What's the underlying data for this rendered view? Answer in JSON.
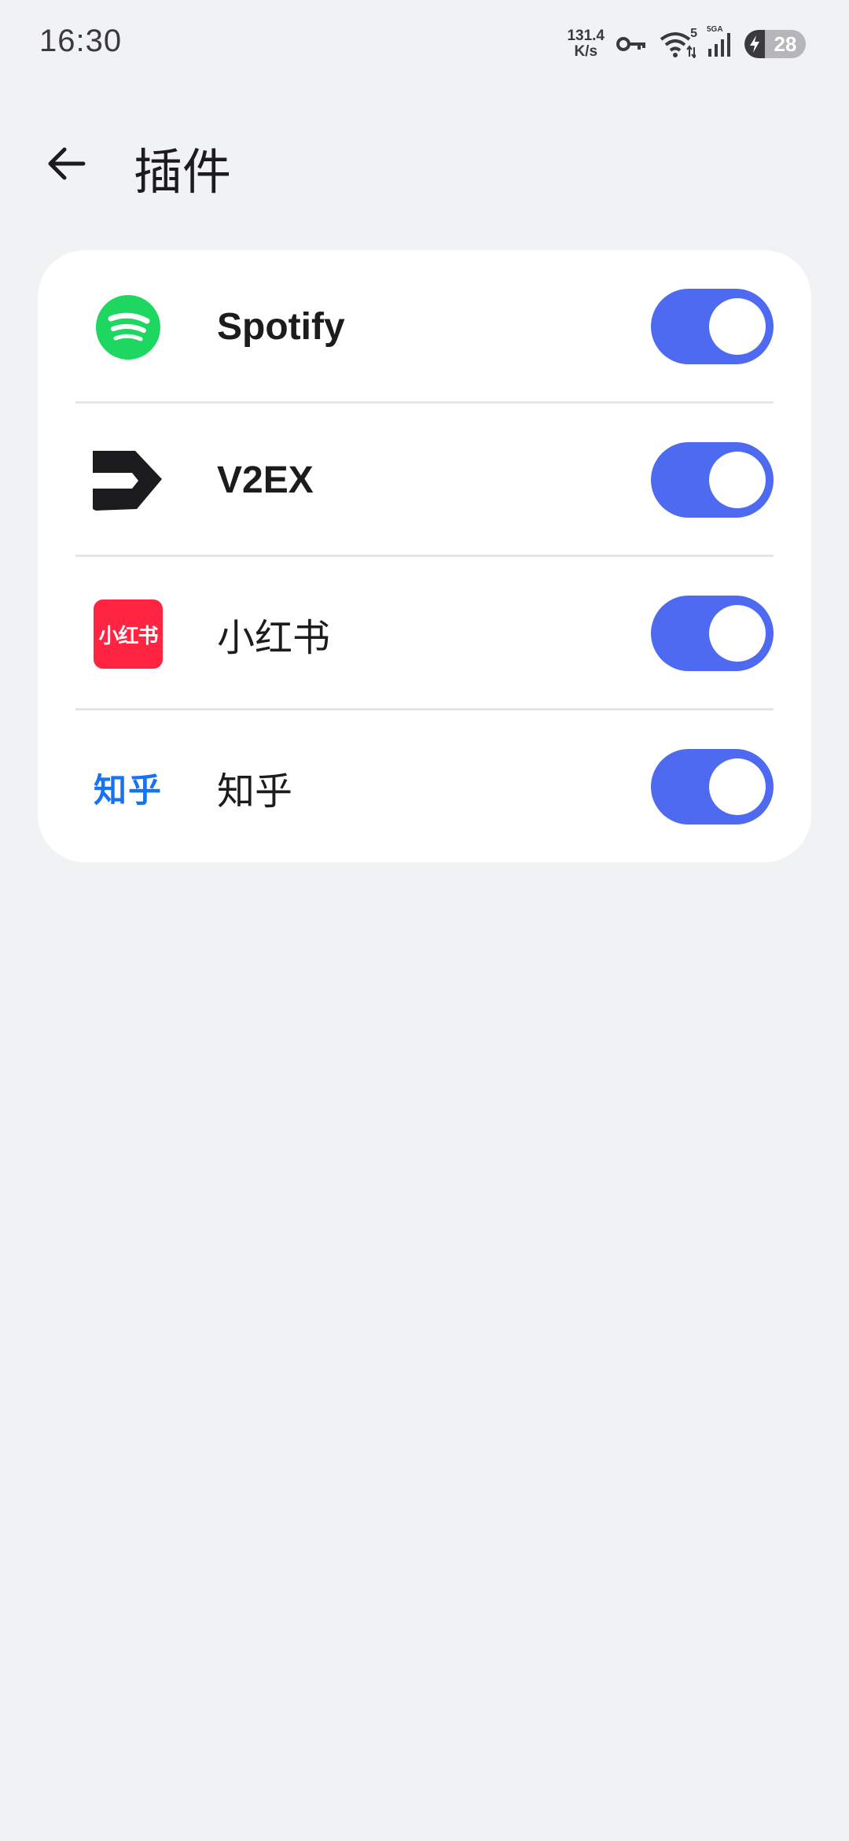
{
  "status_bar": {
    "time": "16:30",
    "net_speed_value": "131.4",
    "net_speed_unit": "K/s",
    "wifi_badge": "5",
    "cell_badge": "5GA",
    "battery_level": "28"
  },
  "app_bar": {
    "title": "插件",
    "back_icon": "arrow-left-icon"
  },
  "plugins": [
    {
      "name": "Spotify",
      "icon": "spotify-logo-icon",
      "enabled": true
    },
    {
      "name": "V2EX",
      "icon": "v2ex-logo-icon",
      "enabled": true
    },
    {
      "name": "小红书",
      "icon": "xiaohongshu-logo-icon",
      "icon_text": "小红书",
      "enabled": true
    },
    {
      "name": "知乎",
      "icon": "zhihu-logo-icon",
      "icon_text": "知乎",
      "enabled": true
    }
  ],
  "colors": {
    "accent": "#4d6af0",
    "background": "#f1f2f4",
    "card": "#ffffff",
    "spotify_green": "#1ed760",
    "xiaohongshu_red": "#ff2442",
    "zhihu_blue": "#1772f6"
  }
}
